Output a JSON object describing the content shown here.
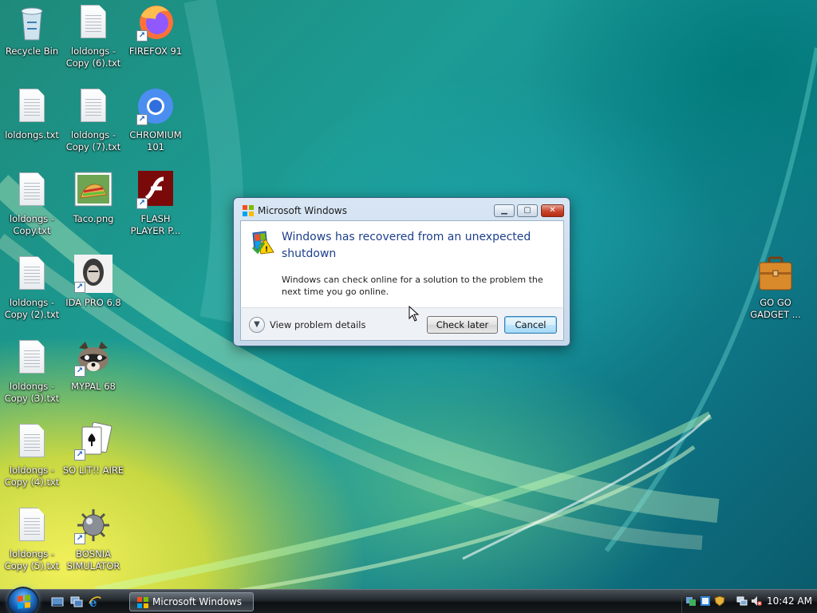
{
  "desktop": {
    "icons": [
      {
        "label": "Recycle Bin",
        "icon": "recycle-bin-icon"
      },
      {
        "label": "loldongs - Copy (6).txt",
        "icon": "text-file-icon"
      },
      {
        "label": "FIREFOX 91",
        "icon": "firefox-icon"
      },
      {
        "label": "loldongs.txt",
        "icon": "text-file-icon"
      },
      {
        "label": "loldongs - Copy (7).txt",
        "icon": "text-file-icon"
      },
      {
        "label": "CHROMIUM 101",
        "icon": "chromium-icon"
      },
      {
        "label": "loldongs - Copy.txt",
        "icon": "text-file-icon"
      },
      {
        "label": "Taco.png",
        "icon": "image-file-icon"
      },
      {
        "label": "FLASH PLAYER P...",
        "icon": "flash-player-icon"
      },
      {
        "label": "loldongs - Copy (2).txt",
        "icon": "text-file-icon"
      },
      {
        "label": "IDA PRO 6.8",
        "icon": "ida-pro-icon"
      },
      {
        "label": "loldongs - Copy (3).txt",
        "icon": "text-file-icon"
      },
      {
        "label": "MYPAL 68",
        "icon": "mypal-icon"
      },
      {
        "label": "loldongs - Copy (4).txt",
        "icon": "text-file-icon"
      },
      {
        "label": "SO LIT!! AIRE",
        "icon": "solitaire-icon"
      },
      {
        "label": "loldongs - Copy (5).txt",
        "icon": "text-file-icon"
      },
      {
        "label": "BOSNIA SIMULATOR",
        "icon": "minesweeper-icon"
      },
      {
        "label": "GO GO GADGET ...",
        "icon": "briefcase-icon"
      }
    ]
  },
  "dialog": {
    "title": "Microsoft Windows",
    "heading": "Windows has recovered from an unexpected shutdown",
    "body": "Windows can check online for a solution to the problem the next time you go online.",
    "details_label": "View problem details",
    "check_later_label": "Check later",
    "cancel_label": "Cancel"
  },
  "taskbar": {
    "task_label": "Microsoft Windows",
    "clock": "10:42 AM"
  },
  "colors": {
    "heading_blue": "#1d3f8c",
    "close_red": "#c8442c"
  }
}
